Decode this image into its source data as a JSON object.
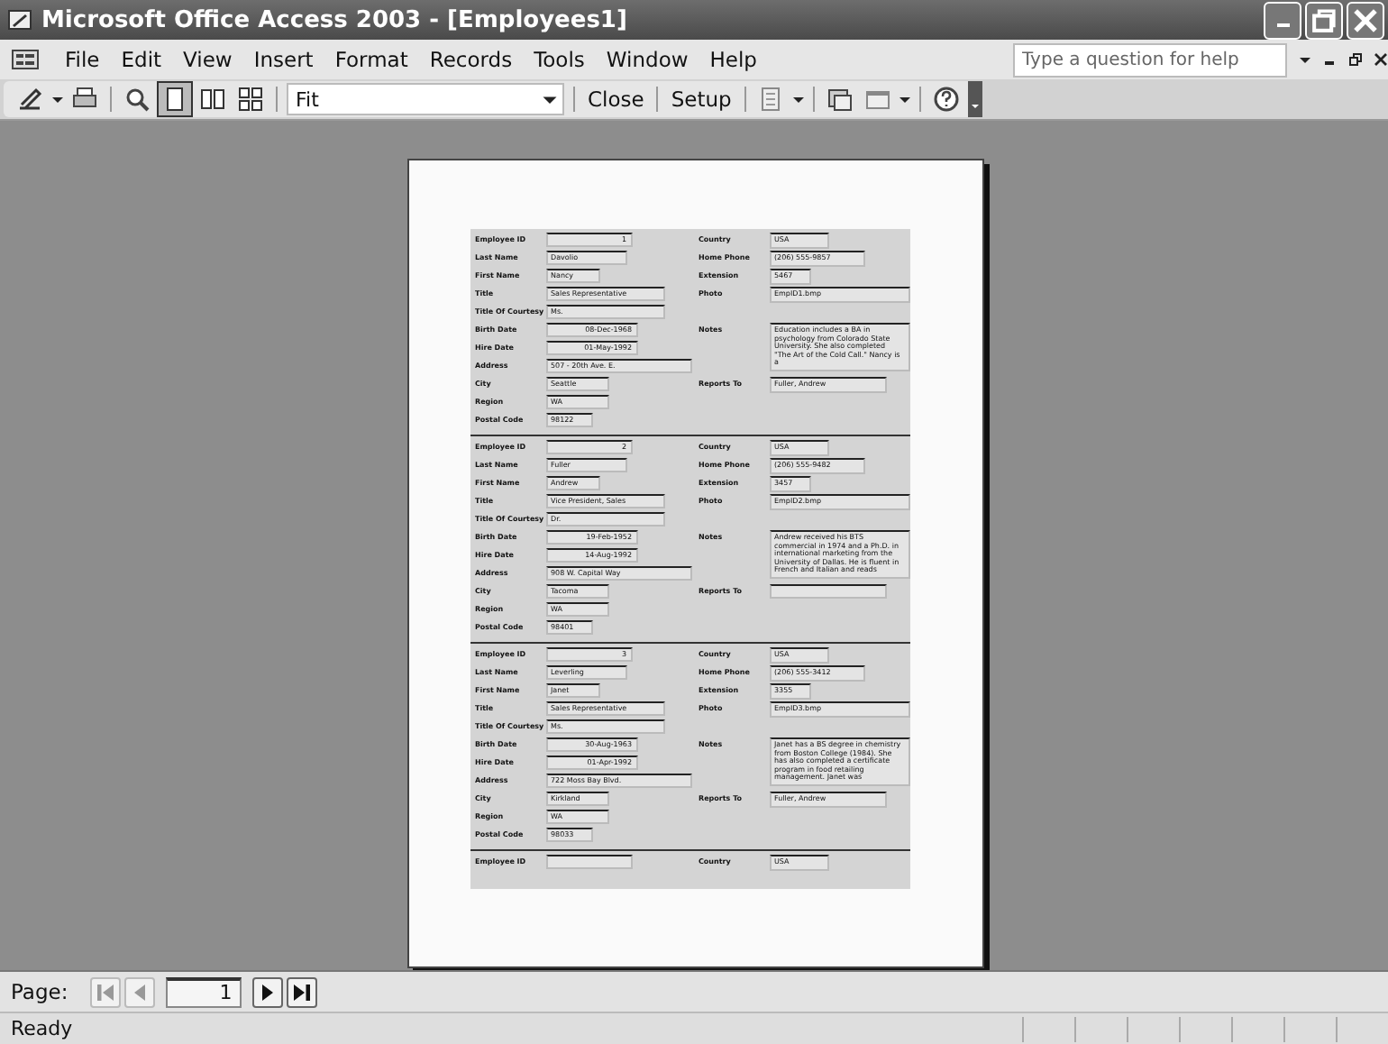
{
  "window": {
    "title": "Microsoft Office Access 2003 - [Employees1]"
  },
  "menu": [
    "File",
    "Edit",
    "View",
    "Insert",
    "Format",
    "Records",
    "Tools",
    "Window",
    "Help"
  ],
  "help_box": {
    "placeholder": "Type a question for help"
  },
  "toolbar": {
    "zoom": "Fit",
    "buttons": [
      "Close",
      "Setup"
    ],
    "one_page_selected": true
  },
  "records": [
    {
      "left": [
        {
          "label": "Employee ID",
          "value": "1"
        },
        {
          "label": "Last Name",
          "value": "Davolio"
        },
        {
          "label": "First Name",
          "value": "Nancy"
        },
        {
          "label": "Title",
          "value": "Sales Representative"
        },
        {
          "label": "Title Of Courtesy",
          "value": "Ms."
        },
        {
          "label": "Birth Date",
          "value": "08-Dec-1968"
        },
        {
          "label": "Hire Date",
          "value": "01-May-1992"
        },
        {
          "label": "Address",
          "value": "507 - 20th Ave. E."
        },
        {
          "label": "City",
          "value": "Seattle"
        },
        {
          "label": "Region",
          "value": "WA"
        },
        {
          "label": "Postal Code",
          "value": "98122"
        }
      ],
      "right": [
        {
          "label": "Country",
          "value": "USA"
        },
        {
          "label": "Home Phone",
          "value": "(206) 555-9857"
        },
        {
          "label": "Extension",
          "value": "5467"
        },
        {
          "label": "Photo",
          "value": "EmpID1.bmp"
        },
        {
          "label": "Notes",
          "value": "Education includes a BA in psychology from Colorado State University. She also completed \"The Art of the Cold Call.\" Nancy is a"
        },
        {
          "label": "Reports To",
          "value": "Fuller, Andrew"
        }
      ]
    },
    {
      "left": [
        {
          "label": "Employee ID",
          "value": "2"
        },
        {
          "label": "Last Name",
          "value": "Fuller"
        },
        {
          "label": "First Name",
          "value": "Andrew"
        },
        {
          "label": "Title",
          "value": "Vice President, Sales"
        },
        {
          "label": "Title Of Courtesy",
          "value": "Dr."
        },
        {
          "label": "Birth Date",
          "value": "19-Feb-1952"
        },
        {
          "label": "Hire Date",
          "value": "14-Aug-1992"
        },
        {
          "label": "Address",
          "value": "908 W. Capital Way"
        },
        {
          "label": "City",
          "value": "Tacoma"
        },
        {
          "label": "Region",
          "value": "WA"
        },
        {
          "label": "Postal Code",
          "value": "98401"
        }
      ],
      "right": [
        {
          "label": "Country",
          "value": "USA"
        },
        {
          "label": "Home Phone",
          "value": "(206) 555-9482"
        },
        {
          "label": "Extension",
          "value": "3457"
        },
        {
          "label": "Photo",
          "value": "EmpID2.bmp"
        },
        {
          "label": "Notes",
          "value": "Andrew received his BTS commercial in 1974 and a Ph.D. in international marketing from the University of Dallas. He is fluent in French and Italian and reads"
        },
        {
          "label": "Reports To"
        }
      ]
    },
    {
      "left": [
        {
          "label": "Employee ID",
          "value": "3"
        },
        {
          "label": "Last Name",
          "value": "Leverling"
        },
        {
          "label": "First Name",
          "value": "Janet"
        },
        {
          "label": "Title",
          "value": "Sales Representative"
        },
        {
          "label": "Title Of Courtesy",
          "value": "Ms."
        },
        {
          "label": "Birth Date",
          "value": "30-Aug-1963"
        },
        {
          "label": "Hire Date",
          "value": "01-Apr-1992"
        },
        {
          "label": "Address",
          "value": "722 Moss Bay Blvd."
        },
        {
          "label": "City",
          "value": "Kirkland"
        },
        {
          "label": "Region",
          "value": "WA"
        },
        {
          "label": "Postal Code",
          "value": "98033"
        }
      ],
      "right": [
        {
          "label": "Country",
          "value": "USA"
        },
        {
          "label": "Home Phone",
          "value": "(206) 555-3412"
        },
        {
          "label": "Extension",
          "value": "3355"
        },
        {
          "label": "Photo",
          "value": "EmpID3.bmp"
        },
        {
          "label": "Notes",
          "value": "Janet has a BS degree in chemistry from Boston College (1984). She has also completed a certificate program in food retailing management. Janet was"
        },
        {
          "label": "Reports To",
          "value": "Fuller, Andrew"
        }
      ]
    },
    {
      "left": [
        {
          "label": "Employee ID"
        }
      ],
      "right": [
        {
          "label": "Country",
          "value": "USA"
        }
      ]
    }
  ],
  "page_nav": {
    "label": "Page:",
    "page": "1"
  },
  "status_bar": {
    "text": "Ready"
  }
}
